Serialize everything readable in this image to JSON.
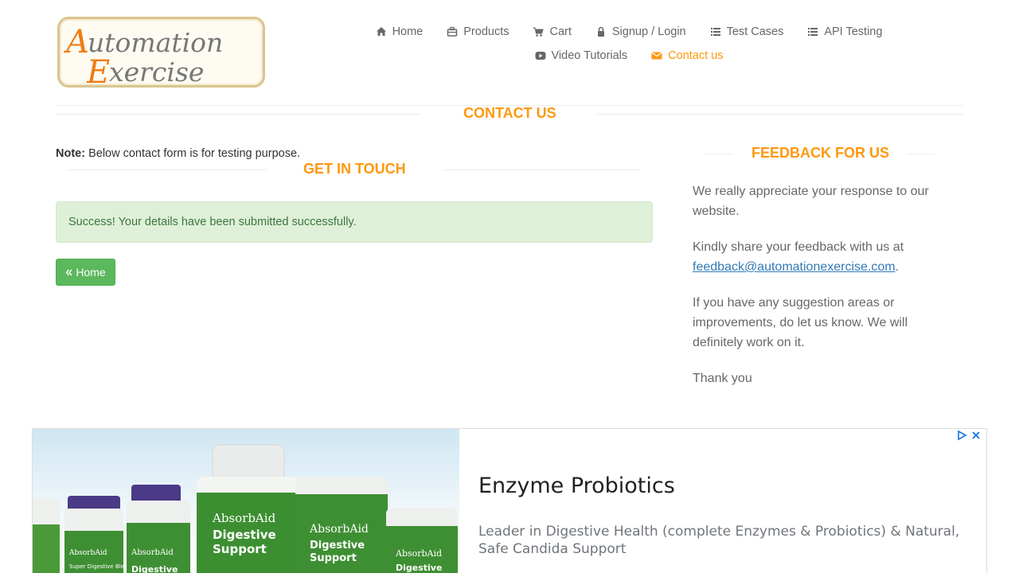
{
  "logo": {
    "line1": "Automation",
    "line2": "Exercise"
  },
  "nav": {
    "row1": [
      {
        "label": "Home",
        "icon": "home-icon"
      },
      {
        "label": "Products",
        "icon": "briefcase-icon"
      },
      {
        "label": "Cart",
        "icon": "cart-icon"
      },
      {
        "label": "Signup / Login",
        "icon": "lock-icon"
      },
      {
        "label": "Test Cases",
        "icon": "list-icon"
      },
      {
        "label": "API Testing",
        "icon": "list-icon"
      }
    ],
    "row2": [
      {
        "label": "Video Tutorials",
        "icon": "youtube-play-icon"
      },
      {
        "label": "Contact us",
        "icon": "envelope-icon",
        "active": true
      }
    ]
  },
  "contact": {
    "title": "Contact Us",
    "note_label": "Note:",
    "note_text": " Below contact form is for testing purpose.",
    "get_in_touch": "Get In Touch",
    "success": "Success! Your details have been submitted successfully.",
    "home_button": "Home"
  },
  "feedback": {
    "title": "Feedback For Us",
    "p1": "We really appreciate your response to our website.",
    "p2_text": "Kindly share your feedback with us at",
    "p2_email": "feedback@automationexercise.com",
    "p2_end": ".",
    "p3": "If you have any suggestion areas or improvements, do let us know. We will definitely work on it.",
    "p4": "Thank you"
  },
  "ad": {
    "title": "Enzyme Probiotics",
    "description": "Leader in Digestive Health (complete Enzymes & Probiotics) & Natural, Safe Candida Support",
    "product_brand": "AbsorbAid",
    "product_name": "Digestive Support",
    "product_line": "Super Digestive Blend"
  },
  "colors": {
    "accent": "#fe980f",
    "success_bg": "#dff0d8",
    "success_text": "#3c763d",
    "button": "#5cb85c",
    "link": "#337ab7"
  }
}
